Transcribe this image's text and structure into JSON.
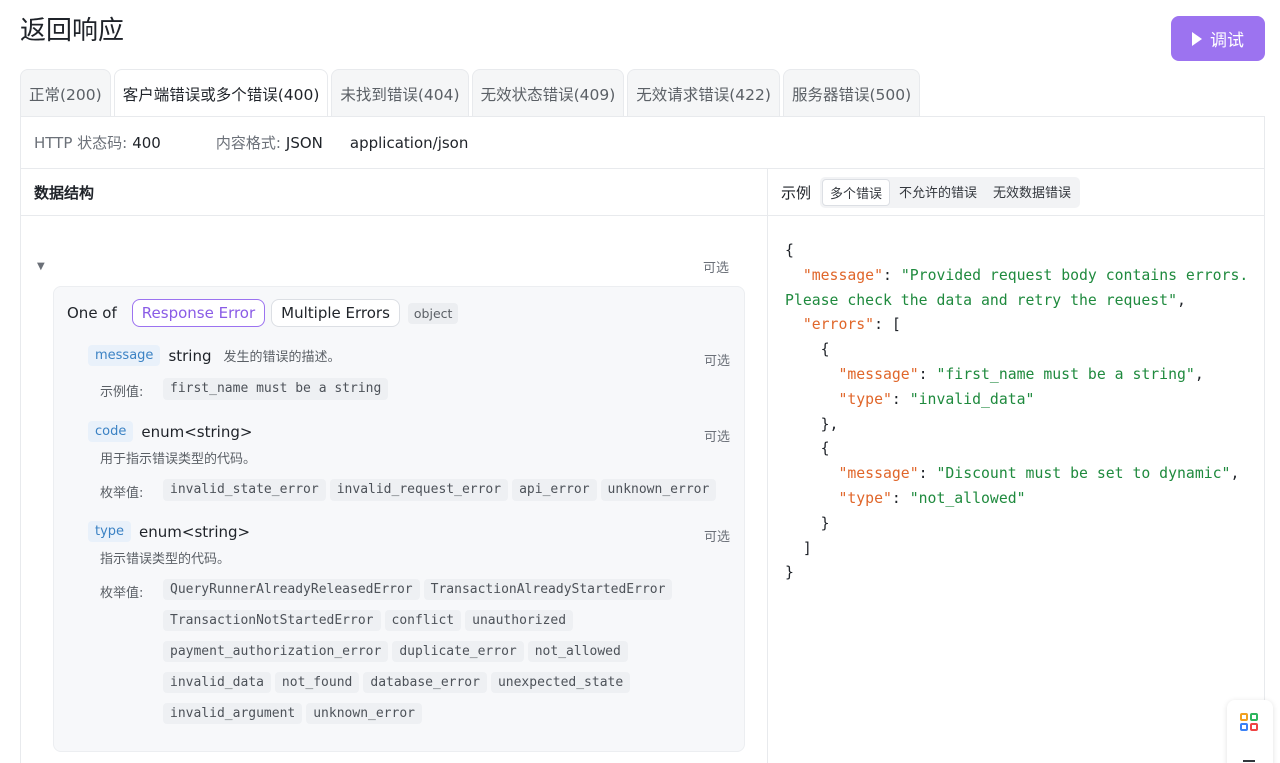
{
  "page": {
    "title": "返回响应",
    "debug_label": "调试"
  },
  "tabs": [
    {
      "label": "正常(200)",
      "active": false
    },
    {
      "label": "客户端错误或多个错误(400)",
      "active": true
    },
    {
      "label": "未找到错误(404)",
      "active": false
    },
    {
      "label": "无效状态错误(409)",
      "active": false
    },
    {
      "label": "无效请求错误(422)",
      "active": false
    },
    {
      "label": "服务器错误(500)",
      "active": false
    }
  ],
  "meta": {
    "status_label": "HTTP 状态码:",
    "status_value": "400",
    "format_label": "内容格式:",
    "format_value": "JSON",
    "mime": "application/json"
  },
  "schema": {
    "heading": "数据结构",
    "optional": "可选",
    "one_of_label": "One of",
    "variants": [
      "Response Error",
      "Multiple Errors"
    ],
    "object_tag": "object",
    "fields": [
      {
        "name": "message",
        "type": "string",
        "desc": "发生的错误的描述。",
        "optional": "可选",
        "sub_label": "示例值:",
        "values": [
          "first_name must be a string"
        ]
      },
      {
        "name": "code",
        "type": "enum<string>",
        "desc": "用于指示错误类型的代码。",
        "optional": "可选",
        "sub_label": "枚举值:",
        "values": [
          "invalid_state_error",
          "invalid_request_error",
          "api_error",
          "unknown_error"
        ]
      },
      {
        "name": "type",
        "type": "enum<string>",
        "desc": "指示错误类型的代码。",
        "optional": "可选",
        "sub_label": "枚举值:",
        "values": [
          "QueryRunnerAlreadyReleasedError",
          "TransactionAlreadyStartedError",
          "TransactionNotStartedError",
          "conflict",
          "unauthorized",
          "payment_authorization_error",
          "duplicate_error",
          "not_allowed",
          "invalid_data",
          "not_found",
          "database_error",
          "unexpected_state",
          "invalid_argument",
          "unknown_error"
        ]
      }
    ]
  },
  "example": {
    "heading": "示例",
    "tabs": [
      {
        "label": "多个错误",
        "active": true
      },
      {
        "label": "不允许的错误",
        "active": false
      },
      {
        "label": "无效数据错误",
        "active": false
      }
    ],
    "json": {
      "message": "Provided request body contains errors. Please check the data and retry the request",
      "errors": [
        {
          "message": "first_name must be a string",
          "type": "invalid_data"
        },
        {
          "message": "Discount must be set to dynamic",
          "type": "not_allowed"
        }
      ]
    }
  },
  "colors": {
    "accent": "#9c73f0",
    "json_key": "#e0662a",
    "json_string": "#1f8a3e",
    "field_name": "#3b82c4"
  },
  "icons": {
    "debug": "play-icon",
    "collapse": "caret-down-icon",
    "float_top": "apps-grid-icon",
    "float_bottom": "minus-icon"
  }
}
